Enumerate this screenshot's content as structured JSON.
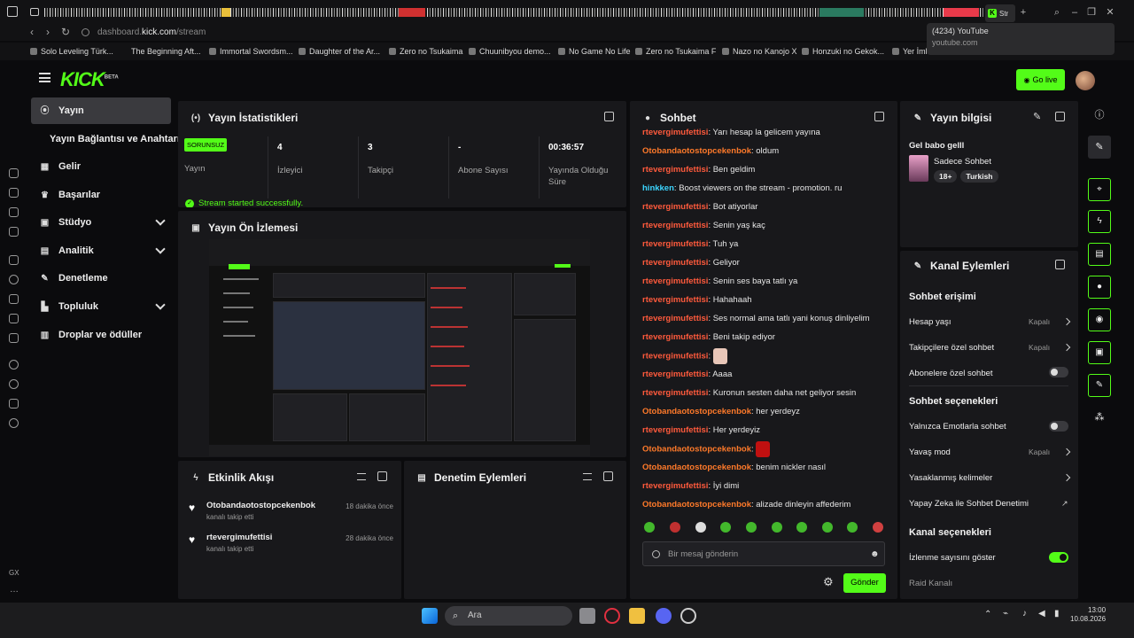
{
  "browser": {
    "active_tab_label": "Str",
    "url_prefix": "dashboard.",
    "url_host": "kick.com",
    "url_path": "/stream",
    "tooltip_title": "(4234) YouTube",
    "tooltip_sub": "youtube.com",
    "bookmarks": [
      "Solo Leveling Türk...",
      "The Beginning Aft...",
      "Immortal Swordsm...",
      "Daughter of the Ar...",
      "Zero no Tsukaima",
      "Chuunibyou demo...",
      "No Game No Life",
      "Zero no Tsukaima F",
      "Nazo no Kanojo X",
      "Honzuki no Gekok...",
      "Yer İmle"
    ]
  },
  "header": {
    "logo": "KICK",
    "logo_sup": "BETA",
    "go_live": "Go live"
  },
  "sidebar": {
    "items": [
      {
        "label": "Yayın",
        "icon": "broadcast-icon"
      },
      {
        "label": "Yayın Bağlantısı ve Anahtarı",
        "icon": ""
      },
      {
        "label": "Gelir",
        "icon": "chart-icon"
      },
      {
        "label": "Başarılar",
        "icon": "trophy-icon"
      },
      {
        "label": "Stüdyo",
        "icon": "studio-icon"
      },
      {
        "label": "Analitik",
        "icon": "analytics-icon"
      },
      {
        "label": "Denetleme",
        "icon": "wrench-icon"
      },
      {
        "label": "Topluluk",
        "icon": "community-icon"
      },
      {
        "label": "Droplar ve ödüller",
        "icon": "drops-icon"
      }
    ]
  },
  "stats": {
    "title": "Yayın İstatistikleri",
    "badge": "SORUNSUZ",
    "items": [
      {
        "value": "",
        "label": "Yayın"
      },
      {
        "value": "4",
        "label": "İzleyici"
      },
      {
        "value": "3",
        "label": "Takipçi"
      },
      {
        "value": "-",
        "label": "Abone Sayısı"
      },
      {
        "value": "00:36:57",
        "label": "Yayında Olduğu Süre"
      }
    ],
    "success": "Stream started successfully."
  },
  "preview": {
    "title": "Yayın Ön İzlemesi"
  },
  "events": {
    "title": "Etkinlik Akışı",
    "items": [
      {
        "name": "Otobandaotostopcekenbok",
        "sub": "kanalı takip etti",
        "time": "18 dakika önce"
      },
      {
        "name": "rtevergimufettisi",
        "sub": "kanalı takip etti",
        "time": "28 dakika önce"
      }
    ]
  },
  "moderation": {
    "title": "Denetim Eylemleri"
  },
  "chat": {
    "title": "Sohbet",
    "messages": [
      {
        "user": "rtevergimufettisi",
        "text": "Yarı hesap la gelicem yayına",
        "color": "#ff5a3c"
      },
      {
        "user": "Otobandaotostopcekenbok",
        "text": "oldum",
        "color": "#ff7a2a"
      },
      {
        "user": "rtevergimufettisi",
        "text": "Ben geldim",
        "color": "#ff5a3c"
      },
      {
        "user": "hinkken",
        "text": "Boost viewers on the stream - promotion. ru",
        "color": "#3cd5ff"
      },
      {
        "user": "rtevergimufettisi",
        "text": "Bot atiyorlar",
        "color": "#ff5a3c"
      },
      {
        "user": "rtevergimufettisi",
        "text": "Senin yaş kaç",
        "color": "#ff5a3c"
      },
      {
        "user": "rtevergimufettisi",
        "text": "Tuh ya",
        "color": "#ff5a3c"
      },
      {
        "user": "rtevergimufettisi",
        "text": "Geliyor",
        "color": "#ff5a3c"
      },
      {
        "user": "rtevergimufettisi",
        "text": "Senin ses baya tatlı ya",
        "color": "#ff5a3c"
      },
      {
        "user": "rtevergimufettisi",
        "text": "Hahahaah",
        "color": "#ff5a3c"
      },
      {
        "user": "rtevergimufettisi",
        "text": "Ses normal ama tatlı yani konuş dinliyelim",
        "color": "#ff5a3c"
      },
      {
        "user": "rtevergimufettisi",
        "text": "Beni takip ediyor",
        "color": "#ff5a3c"
      },
      {
        "user": "rtevergimufettisi",
        "text": "",
        "color": "#ff5a3c",
        "emote": "#e8c6b8"
      },
      {
        "user": "rtevergimufettisi",
        "text": "Aaaa",
        "color": "#ff5a3c"
      },
      {
        "user": "rtevergimufettisi",
        "text": "Kuronun sesten daha net geliyor sesin",
        "color": "#ff5a3c"
      },
      {
        "user": "Otobandaotostopcekenbok",
        "text": "her yerdeyz",
        "color": "#ff7a2a"
      },
      {
        "user": "rtevergimufettisi",
        "text": "Her yerdeyiz",
        "color": "#ff5a3c"
      },
      {
        "user": "Otobandaotostopcekenbok",
        "text": "",
        "color": "#ff7a2a",
        "emote": "#c01010"
      },
      {
        "user": "Otobandaotostopcekenbok",
        "text": "benim nickler nasıl",
        "color": "#ff7a2a"
      },
      {
        "user": "rtevergimufettisi",
        "text": "İyi dimi",
        "color": "#ff5a3c"
      },
      {
        "user": "Otobandaotostopcekenbok",
        "text": "alizade dinleyin affederim",
        "color": "#ff7a2a"
      }
    ],
    "placeholder": "Bir mesaj gönderin",
    "send": "Gönder"
  },
  "stream_info": {
    "title": "Yayın bilgisi",
    "stream_title": "Gel babo gelll",
    "category": "Sadece Sohbet",
    "tags": [
      "18+",
      "Turkish"
    ]
  },
  "channel_actions": {
    "title": "Kanal Eylemleri",
    "chat_access": "Sohbet erişimi",
    "account_age": "Hesap yaşı",
    "account_age_val": "Kapalı",
    "followers_only": "Takipçilere özel sohbet",
    "followers_only_val": "Kapalı",
    "subs_only": "Abonelere özel sohbet",
    "chat_options": "Sohbet seçenekleri",
    "emotes_only": "Yalnızca Emotlarla sohbet",
    "slow_mode": "Yavaş mod",
    "slow_mode_val": "Kapalı",
    "banned_words": "Yasaklanmış kelimeler",
    "ai_moderation": "Yapay Zeka ile Sohbet Denetimi",
    "channel_options": "Kanal seçenekleri",
    "show_viewers": "İzlenme sayısını göster",
    "raid": "Raid Kanalı"
  },
  "taskbar": {
    "search": "Ara",
    "time": "13:00",
    "date": "10.08.2026"
  }
}
